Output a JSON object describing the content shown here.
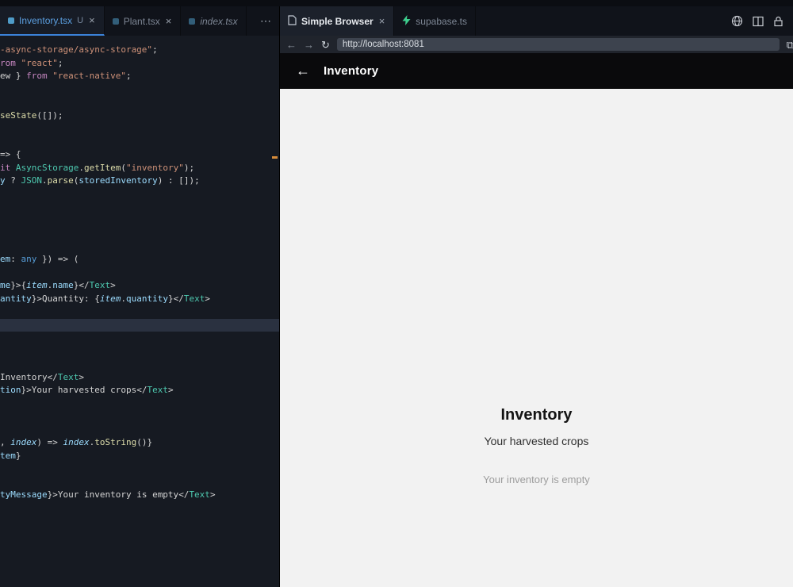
{
  "colors": {
    "accent_blue": "#3b82d8",
    "editor_background": "#161a22",
    "overview_marker_orange": "#d78c3a",
    "supabase_green": "#3ecf8e",
    "app_background": "#f2f2f2",
    "app_header_black": "#0a0a0c"
  },
  "icons": {
    "close": "×",
    "more": "⋯",
    "back": "←",
    "forward": "→",
    "reload": "↻",
    "open_external": "⧉",
    "app_back": "←"
  },
  "editor": {
    "tabs": [
      {
        "label": "Inventory.tsx",
        "badge": "U"
      },
      {
        "label": "Plant.tsx"
      },
      {
        "label": "index.tsx"
      }
    ],
    "code_lines": [
      {
        "tokens": [
          [
            "-async-storage/async-storage\"",
            "str"
          ],
          [
            ";",
            "fg"
          ]
        ]
      },
      {
        "tokens": [
          [
            "rom ",
            "kw"
          ],
          [
            "\"react\"",
            "str"
          ],
          [
            ";",
            "fg"
          ]
        ]
      },
      {
        "tokens": [
          [
            "ew } ",
            "fg"
          ],
          [
            "from ",
            "kw"
          ],
          [
            "\"react-native\"",
            "str"
          ],
          [
            ";",
            "fg"
          ]
        ]
      },
      {
        "tokens": []
      },
      {
        "tokens": []
      },
      {
        "tokens": [
          [
            "seState",
            "fn"
          ],
          [
            "([]);",
            "fg"
          ]
        ]
      },
      {
        "tokens": []
      },
      {
        "tokens": []
      },
      {
        "tokens": [
          [
            "=> {",
            "fg"
          ]
        ]
      },
      {
        "tokens": [
          [
            "it ",
            "kw"
          ],
          [
            "AsyncStorage",
            "cls"
          ],
          [
            ".",
            "fg"
          ],
          [
            "getItem",
            "fn"
          ],
          [
            "(",
            "fg"
          ],
          [
            "\"inventory\"",
            "str"
          ],
          [
            ");",
            "fg"
          ]
        ]
      },
      {
        "tokens": [
          [
            "y",
            "var"
          ],
          [
            " ? ",
            "fg"
          ],
          [
            "JSON",
            "cls"
          ],
          [
            ".",
            "fg"
          ],
          [
            "parse",
            "fn"
          ],
          [
            "(",
            "fg"
          ],
          [
            "storedInventory",
            "var"
          ],
          [
            ") : []);",
            "fg"
          ]
        ]
      },
      {
        "tokens": []
      },
      {
        "tokens": []
      },
      {
        "tokens": []
      },
      {
        "tokens": []
      },
      {
        "tokens": []
      },
      {
        "tokens": [
          [
            "em",
            "var"
          ],
          [
            ": ",
            "fg"
          ],
          [
            "any",
            "kb"
          ],
          [
            " }) => (",
            "fg"
          ]
        ]
      },
      {
        "tokens": []
      },
      {
        "tokens": [
          [
            "me",
            "var"
          ],
          [
            "}>{",
            "fg"
          ],
          [
            "item",
            "vi"
          ],
          [
            ".",
            "fg"
          ],
          [
            "name",
            "var"
          ],
          [
            "}",
            "fg"
          ],
          [
            "</",
            "fg"
          ],
          [
            "Text",
            "cls"
          ],
          [
            ">",
            "fg"
          ]
        ]
      },
      {
        "tokens": [
          [
            "antity",
            "var"
          ],
          [
            "}>",
            "fg"
          ],
          [
            "Quantity: ",
            "fg"
          ],
          [
            "{",
            "fg"
          ],
          [
            "item",
            "vi"
          ],
          [
            ".",
            "fg"
          ],
          [
            "quantity",
            "var"
          ],
          [
            "}",
            "fg"
          ],
          [
            "</",
            "fg"
          ],
          [
            "Text",
            "cls"
          ],
          [
            ">",
            "fg"
          ]
        ]
      },
      {
        "tokens": []
      },
      {
        "tokens": [],
        "sel": true
      },
      {
        "tokens": []
      },
      {
        "tokens": []
      },
      {
        "tokens": []
      },
      {
        "tokens": [
          [
            "Inventory",
            "fg"
          ],
          [
            "</",
            "fg"
          ],
          [
            "Text",
            "cls"
          ],
          [
            ">",
            "fg"
          ]
        ]
      },
      {
        "tokens": [
          [
            "tion",
            "var"
          ],
          [
            "}>",
            "fg"
          ],
          [
            "Your harvested crops",
            "fg"
          ],
          [
            "</",
            "fg"
          ],
          [
            "Text",
            "cls"
          ],
          [
            ">",
            "fg"
          ]
        ]
      },
      {
        "tokens": []
      },
      {
        "tokens": []
      },
      {
        "tokens": []
      },
      {
        "tokens": [
          [
            ", ",
            "fg"
          ],
          [
            "index",
            "vi"
          ],
          [
            ") => ",
            "fg"
          ],
          [
            "index",
            "vi"
          ],
          [
            ".",
            "fg"
          ],
          [
            "toString",
            "fn"
          ],
          [
            "()}",
            "fg"
          ]
        ]
      },
      {
        "tokens": [
          [
            "tem",
            "var"
          ],
          [
            "}",
            "fg"
          ]
        ]
      },
      {
        "tokens": []
      },
      {
        "tokens": []
      },
      {
        "tokens": [
          [
            "tyMessage",
            "var"
          ],
          [
            "}>",
            "fg"
          ],
          [
            "Your inventory is empty",
            "fg"
          ],
          [
            "</",
            "fg"
          ],
          [
            "Text",
            "cls"
          ],
          [
            ">",
            "fg"
          ]
        ]
      }
    ]
  },
  "browser": {
    "tabs": [
      {
        "label": "Simple Browser"
      },
      {
        "label": "supabase.ts"
      }
    ],
    "url": "http://localhost:8081",
    "app": {
      "header_title": "Inventory",
      "heading": "Inventory",
      "subheading": "Your harvested crops",
      "empty_message": "Your inventory is empty"
    }
  }
}
